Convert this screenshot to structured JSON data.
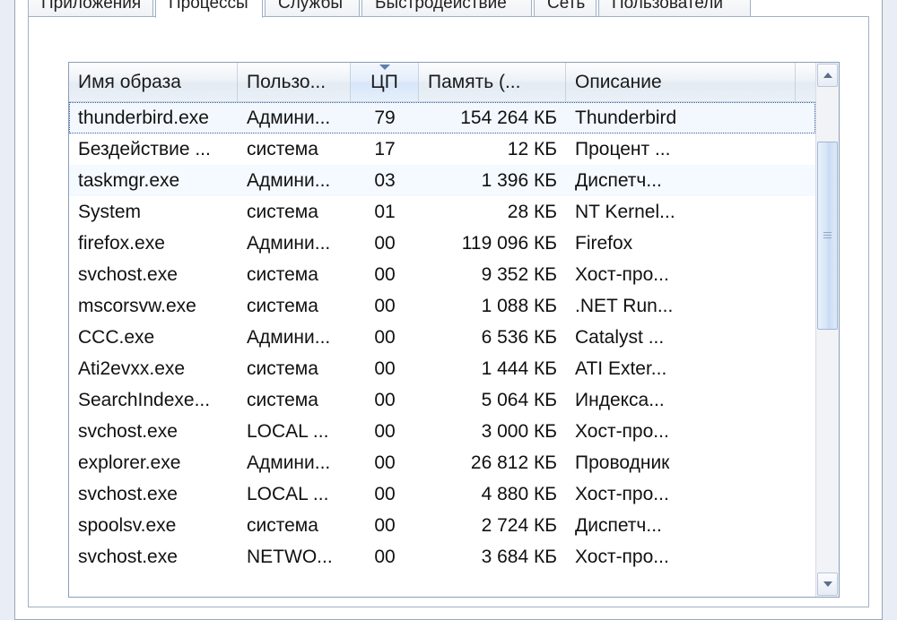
{
  "tabs": {
    "t0": "Приложения",
    "t1": "Процессы",
    "t2": "Службы",
    "t3": "Быстродействие",
    "t4": "Сеть",
    "t5": "Пользователи"
  },
  "columns": {
    "image": "Имя образа",
    "user": "Пользо...",
    "cpu": "ЦП",
    "mem": "Память (...",
    "desc": "Описание"
  },
  "rows": [
    {
      "image": "thunderbird.exe",
      "user": "Админи...",
      "cpu": "79",
      "mem": "154 264 КБ",
      "desc": "Thunderbird",
      "selected": true
    },
    {
      "image": "Бездействие ...",
      "user": "система",
      "cpu": "17",
      "mem": "12 КБ",
      "desc": "Процент ..."
    },
    {
      "image": "taskmgr.exe",
      "user": "Админи...",
      "cpu": "03",
      "mem": "1 396 КБ",
      "desc": "Диспетч...",
      "hover": true
    },
    {
      "image": "System",
      "user": "система",
      "cpu": "01",
      "mem": "28 КБ",
      "desc": "NT Kernel..."
    },
    {
      "image": "firefox.exe",
      "user": "Админи...",
      "cpu": "00",
      "mem": "119 096 КБ",
      "desc": "Firefox"
    },
    {
      "image": "svchost.exe",
      "user": "система",
      "cpu": "00",
      "mem": "9 352 КБ",
      "desc": "Хост-про..."
    },
    {
      "image": "mscorsvw.exe",
      "user": "система",
      "cpu": "00",
      "mem": "1 088 КБ",
      "desc": ".NET Run..."
    },
    {
      "image": "CCC.exe",
      "user": "Админи...",
      "cpu": "00",
      "mem": "6 536 КБ",
      "desc": "Catalyst ..."
    },
    {
      "image": "Ati2evxx.exe",
      "user": "система",
      "cpu": "00",
      "mem": "1 444 КБ",
      "desc": "ATI Exter..."
    },
    {
      "image": "SearchIndexe...",
      "user": "система",
      "cpu": "00",
      "mem": "5 064 КБ",
      "desc": "Индекса..."
    },
    {
      "image": "svchost.exe",
      "user": "LOCAL ...",
      "cpu": "00",
      "mem": "3 000 КБ",
      "desc": "Хост-про..."
    },
    {
      "image": "explorer.exe",
      "user": "Админи...",
      "cpu": "00",
      "mem": "26 812 КБ",
      "desc": "Проводник"
    },
    {
      "image": "svchost.exe",
      "user": "LOCAL ...",
      "cpu": "00",
      "mem": "4 880 КБ",
      "desc": "Хост-про..."
    },
    {
      "image": "spoolsv.exe",
      "user": "система",
      "cpu": "00",
      "mem": "2 724 КБ",
      "desc": "Диспетч..."
    },
    {
      "image": "svchost.exe",
      "user": "NETWO...",
      "cpu": "00",
      "mem": "3 684 КБ",
      "desc": "Хост-про..."
    }
  ]
}
